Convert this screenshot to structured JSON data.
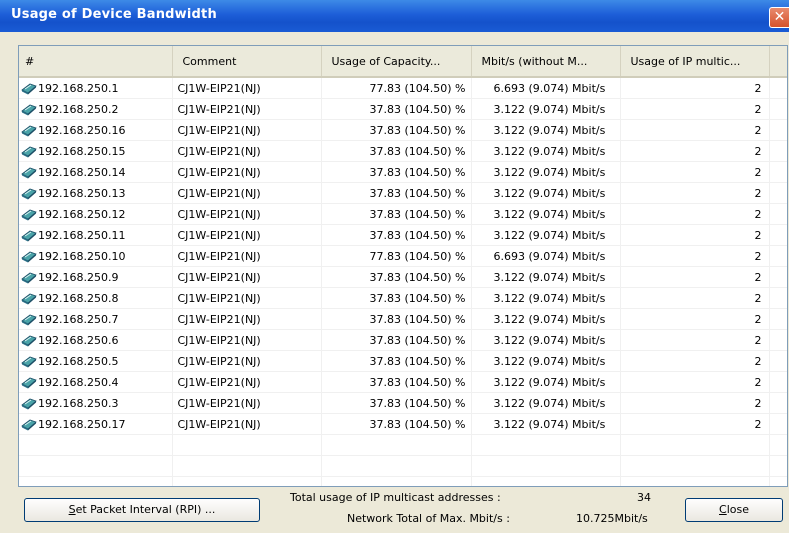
{
  "window": {
    "title": "Usage of Device Bandwidth",
    "close_glyph": "✕"
  },
  "columns": [
    "#",
    "Comment",
    "Usage of Capacity...",
    "Mbit/s (without M...",
    "Usage of IP multic..."
  ],
  "rows": [
    {
      "ip": "192.168.250.1",
      "comment": "CJ1W-EIP21(NJ)",
      "capacity": "77.83 (104.50) %",
      "mbits": "6.693 (9.074) Mbit/s",
      "multicast": "2"
    },
    {
      "ip": "192.168.250.2",
      "comment": "CJ1W-EIP21(NJ)",
      "capacity": "37.83 (104.50) %",
      "mbits": "3.122 (9.074) Mbit/s",
      "multicast": "2"
    },
    {
      "ip": "192.168.250.16",
      "comment": "CJ1W-EIP21(NJ)",
      "capacity": "37.83 (104.50) %",
      "mbits": "3.122 (9.074) Mbit/s",
      "multicast": "2"
    },
    {
      "ip": "192.168.250.15",
      "comment": "CJ1W-EIP21(NJ)",
      "capacity": "37.83 (104.50) %",
      "mbits": "3.122 (9.074) Mbit/s",
      "multicast": "2"
    },
    {
      "ip": "192.168.250.14",
      "comment": "CJ1W-EIP21(NJ)",
      "capacity": "37.83 (104.50) %",
      "mbits": "3.122 (9.074) Mbit/s",
      "multicast": "2"
    },
    {
      "ip": "192.168.250.13",
      "comment": "CJ1W-EIP21(NJ)",
      "capacity": "37.83 (104.50) %",
      "mbits": "3.122 (9.074) Mbit/s",
      "multicast": "2"
    },
    {
      "ip": "192.168.250.12",
      "comment": "CJ1W-EIP21(NJ)",
      "capacity": "37.83 (104.50) %",
      "mbits": "3.122 (9.074) Mbit/s",
      "multicast": "2"
    },
    {
      "ip": "192.168.250.11",
      "comment": "CJ1W-EIP21(NJ)",
      "capacity": "37.83 (104.50) %",
      "mbits": "3.122 (9.074) Mbit/s",
      "multicast": "2"
    },
    {
      "ip": "192.168.250.10",
      "comment": "CJ1W-EIP21(NJ)",
      "capacity": "77.83 (104.50) %",
      "mbits": "6.693 (9.074) Mbit/s",
      "multicast": "2"
    },
    {
      "ip": "192.168.250.9",
      "comment": "CJ1W-EIP21(NJ)",
      "capacity": "37.83 (104.50) %",
      "mbits": "3.122 (9.074) Mbit/s",
      "multicast": "2"
    },
    {
      "ip": "192.168.250.8",
      "comment": "CJ1W-EIP21(NJ)",
      "capacity": "37.83 (104.50) %",
      "mbits": "3.122 (9.074) Mbit/s",
      "multicast": "2"
    },
    {
      "ip": "192.168.250.7",
      "comment": "CJ1W-EIP21(NJ)",
      "capacity": "37.83 (104.50) %",
      "mbits": "3.122 (9.074) Mbit/s",
      "multicast": "2"
    },
    {
      "ip": "192.168.250.6",
      "comment": "CJ1W-EIP21(NJ)",
      "capacity": "37.83 (104.50) %",
      "mbits": "3.122 (9.074) Mbit/s",
      "multicast": "2"
    },
    {
      "ip": "192.168.250.5",
      "comment": "CJ1W-EIP21(NJ)",
      "capacity": "37.83 (104.50) %",
      "mbits": "3.122 (9.074) Mbit/s",
      "multicast": "2"
    },
    {
      "ip": "192.168.250.4",
      "comment": "CJ1W-EIP21(NJ)",
      "capacity": "37.83 (104.50) %",
      "mbits": "3.122 (9.074) Mbit/s",
      "multicast": "2"
    },
    {
      "ip": "192.168.250.3",
      "comment": "CJ1W-EIP21(NJ)",
      "capacity": "37.83 (104.50) %",
      "mbits": "3.122 (9.074) Mbit/s",
      "multicast": "2"
    },
    {
      "ip": "192.168.250.17",
      "comment": "CJ1W-EIP21(NJ)",
      "capacity": "37.83 (104.50) %",
      "mbits": "3.122 (9.074) Mbit/s",
      "multicast": "2"
    }
  ],
  "empty_rows": 3,
  "footer": {
    "rpi_button": {
      "underline": "S",
      "rest": "et Packet Interval (RPI) ..."
    },
    "multicast_label": "Total usage of IP multicast addresses :",
    "multicast_value": "34",
    "network_label": "Network Total of Max. Mbit/s :",
    "network_value": "10.725Mbit/s",
    "close_button": {
      "underline": "C",
      "rest": "lose"
    }
  },
  "icons": {
    "device": "device-icon"
  },
  "colors": {
    "titlebar": "#1d5ed8",
    "close": "#d6522c",
    "dialog": "#ece9d8"
  }
}
